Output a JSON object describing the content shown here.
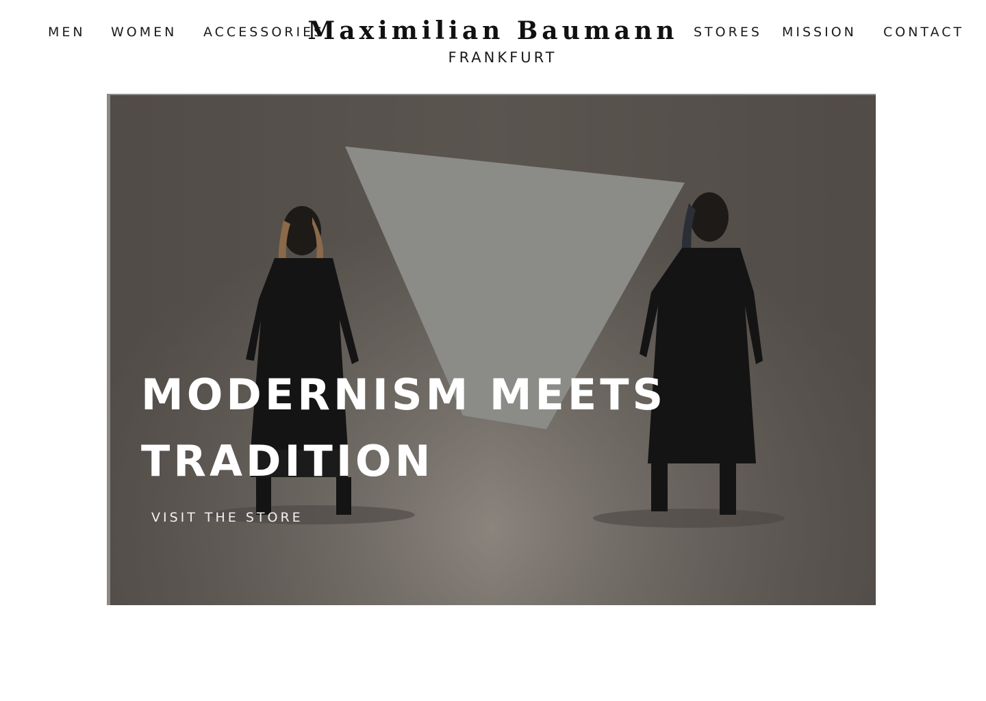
{
  "nav": {
    "left": [
      "MEN",
      "WOMEN",
      "ACCESSORIES"
    ],
    "right": [
      "STORES",
      "MISSION",
      "CONTACT"
    ]
  },
  "brand": {
    "name": "Maximilian Baumann",
    "city": "FRANKFURT"
  },
  "hero": {
    "headline_line1": "MODERNISM MEETS",
    "headline_line2": "TRADITION",
    "cta_label": "VISIT THE STORE"
  },
  "colors": {
    "background": "#ffffff",
    "hero_overlay": "#5b5550",
    "hero_text": "#ffffff"
  }
}
